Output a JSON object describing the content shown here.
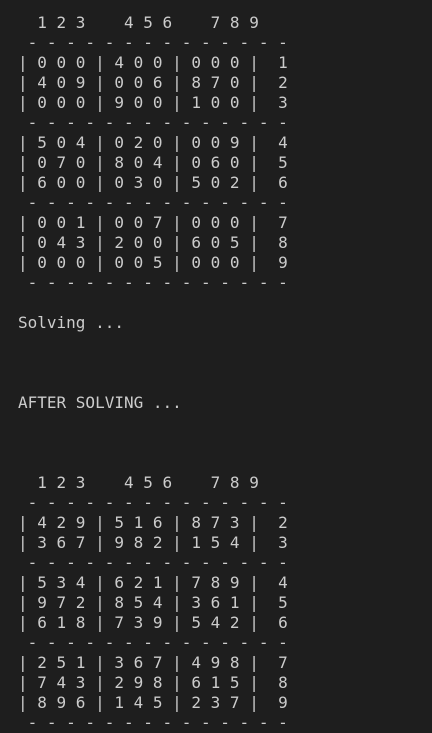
{
  "terminal": {
    "lines": [
      {
        "text": "  1 2 3    4 5 6    7 8 9"
      },
      {
        "text": " - - - - - - - - - - - - - -"
      },
      {
        "text": "| 0 0 0 | 4 0 0 | 0 0 0 |  1"
      },
      {
        "text": "| 4 0 9 | 0 0 6 | 8 7 0 |  2"
      },
      {
        "text": "| 0 0 0 | 9 0 0 | 1 0 0 |  3"
      },
      {
        "text": " - - - - - - - - - - - - - -"
      },
      {
        "text": "| 5 0 4 | 0 2 0 | 0 0 9 |  4"
      },
      {
        "text": "| 0 7 0 | 8 0 4 | 0 6 0 |  5"
      },
      {
        "text": "| 6 0 0 | 0 3 0 | 5 0 2 |  6"
      },
      {
        "text": " - - - - - - - - - - - - - -"
      },
      {
        "text": "| 0 0 1 | 0 0 7 | 0 0 0 |  7"
      },
      {
        "text": "| 0 4 3 | 2 0 0 | 6 0 5 |  8"
      },
      {
        "text": "| 0 0 0 | 0 0 5 | 0 0 0 |  9"
      },
      {
        "text": " - - - - - - - - - - - - - -"
      },
      {
        "text": ""
      },
      {
        "text": "Solving ..."
      },
      {
        "text": ""
      },
      {
        "text": ""
      },
      {
        "text": ""
      },
      {
        "text": "AFTER SOLVING ..."
      },
      {
        "text": ""
      },
      {
        "text": ""
      },
      {
        "text": ""
      },
      {
        "text": "  1 2 3    4 5 6    7 8 9"
      },
      {
        "text": " - - - - - - - - - - - - - -"
      },
      {
        "text": "| 4 2 9 | 5 1 6 | 8 7 3 |  2"
      },
      {
        "text": "| 3 6 7 | 9 8 2 | 1 5 4 |  3"
      },
      {
        "text": " - - - - - - - - - - - - - -"
      },
      {
        "text": "| 5 3 4 | 6 2 1 | 7 8 9 |  4"
      },
      {
        "text": "| 9 7 2 | 8 5 4 | 3 6 1 |  5"
      },
      {
        "text": "| 6 1 8 | 7 3 9 | 5 4 2 |  6"
      },
      {
        "text": " - - - - - - - - - - - - - -"
      },
      {
        "text": "| 2 5 1 | 3 6 7 | 4 9 8 |  7"
      },
      {
        "text": "| 7 4 3 | 2 9 8 | 6 1 5 |  8"
      },
      {
        "text": "| 8 9 6 | 1 4 5 | 2 3 7 |  9"
      },
      {
        "text": " - - - - - - - - - - - - - -"
      }
    ]
  }
}
